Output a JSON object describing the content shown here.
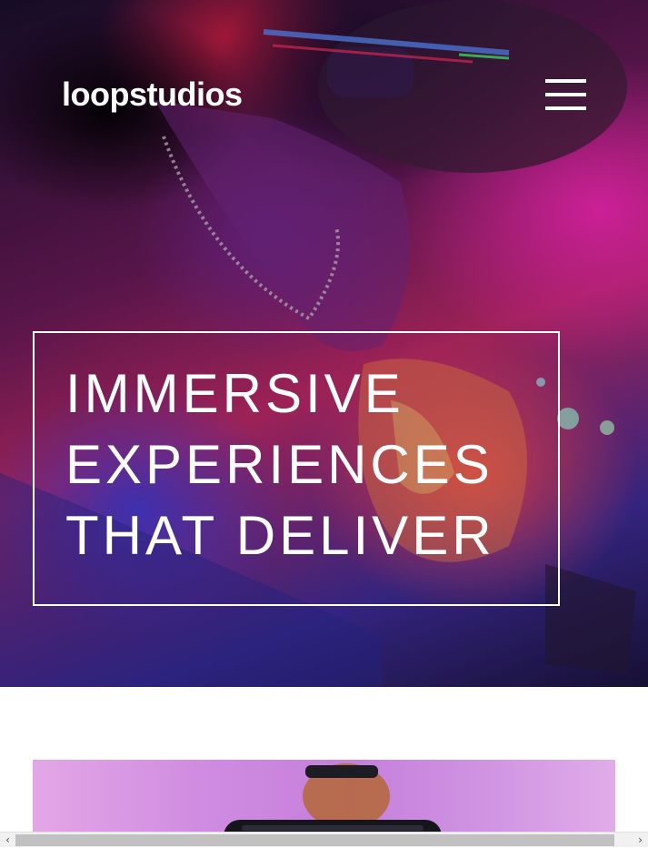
{
  "header": {
    "logo": "loopstudios",
    "menu_icon": "hamburger-menu-icon"
  },
  "hero": {
    "headline_lines": [
      "IMMERSIVE",
      "EXPERIENCES",
      "THAT DELIVER"
    ]
  },
  "creation": {
    "image": "vr-headset-person-photo"
  },
  "colors": {
    "text": "#ffffff",
    "hero_magenta": "#ff28be",
    "hero_blue": "#463cdc",
    "creation_lilac": "#cf8be0"
  },
  "scrollbar": {
    "left_icon": "chevron-left-icon",
    "right_icon": "chevron-right-icon"
  }
}
